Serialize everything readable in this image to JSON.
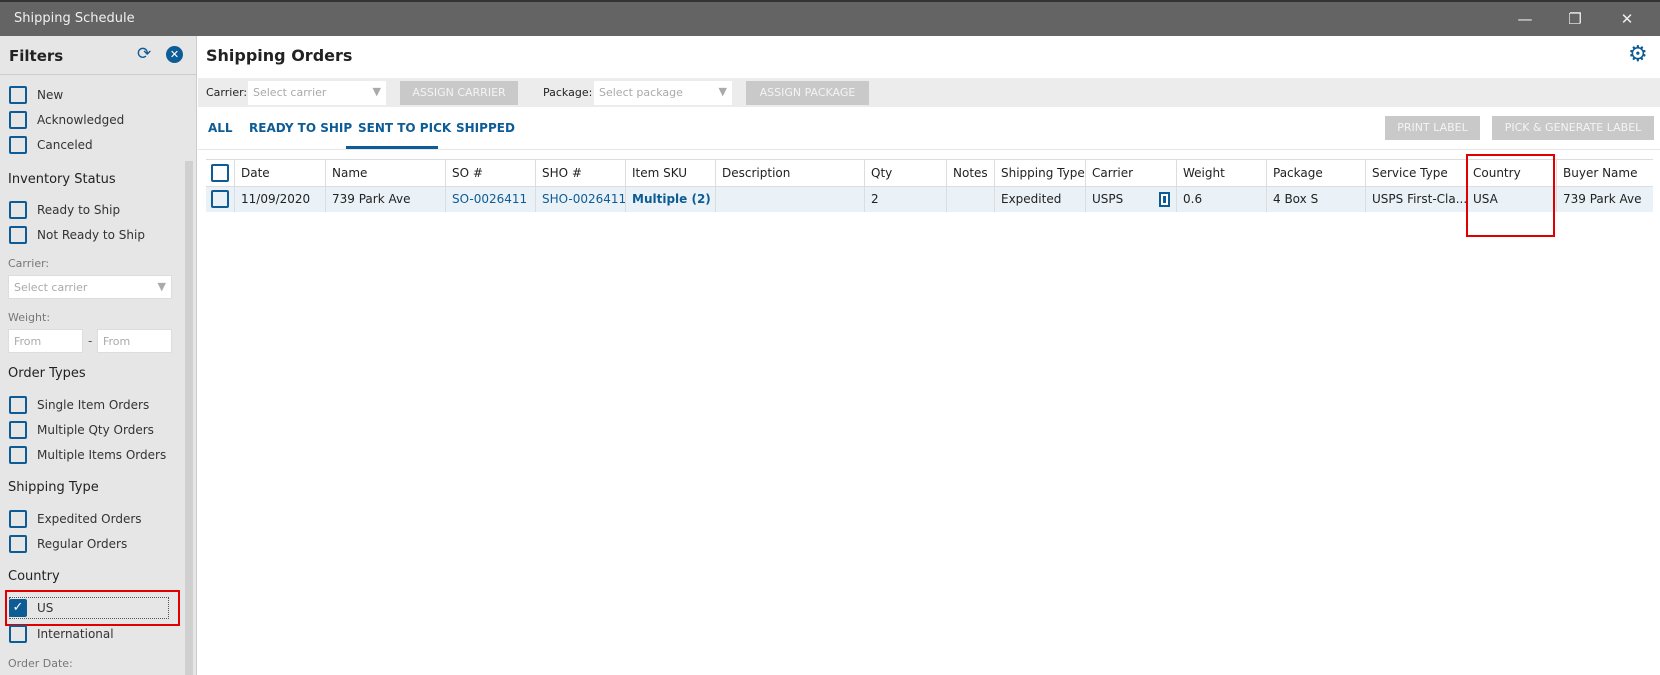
{
  "window": {
    "title": "Shipping Schedule",
    "minimize": "—",
    "restore": "❐",
    "close": "✕"
  },
  "sidebar": {
    "title": "Filters",
    "status_items": [
      {
        "label": "New",
        "checked": false
      },
      {
        "label": "Acknowledged",
        "checked": false
      },
      {
        "label": "Canceled",
        "checked": false
      }
    ],
    "inventory_title": "Inventory Status",
    "inventory_items": [
      {
        "label": "Ready to Ship",
        "checked": false
      },
      {
        "label": "Not Ready to Ship",
        "checked": false
      }
    ],
    "carrier_label": "Carrier:",
    "carrier_placeholder": "Select carrier",
    "weight_label": "Weight:",
    "weight_from_placeholder": "From",
    "weight_dash": "-",
    "weight_to_placeholder": "From",
    "order_types_title": "Order Types",
    "order_types": [
      {
        "label": "Single Item Orders"
      },
      {
        "label": "Multiple Qty Orders"
      },
      {
        "label": "Multiple Items Orders"
      }
    ],
    "shipping_type_title": "Shipping Type",
    "shipping_types": [
      {
        "label": "Expedited Orders"
      },
      {
        "label": "Regular Orders"
      }
    ],
    "country_title": "Country",
    "countries": [
      {
        "label": "US",
        "checked": true
      },
      {
        "label": "International",
        "checked": false
      }
    ],
    "order_date_label": "Order Date:"
  },
  "main": {
    "title": "Shipping Orders",
    "toolbar": {
      "carrier_label": "Carrier:",
      "carrier_placeholder": "Select carrier",
      "assign_carrier": "ASSIGN CARRIER",
      "package_label": "Package:",
      "package_placeholder": "Select package",
      "assign_package": "ASSIGN PACKAGE"
    },
    "tabs": [
      {
        "label": "ALL"
      },
      {
        "label": "READY TO SHIP"
      },
      {
        "label": "SENT TO PICK",
        "active": true
      },
      {
        "label": "SHIPPED"
      }
    ],
    "print_label": "PRINT LABEL",
    "pick_generate": "PICK & GENERATE LABEL",
    "columns": [
      "Date",
      "Name",
      "SO #",
      "SHO #",
      "Item SKU",
      "Description",
      "Qty",
      "Notes",
      "Shipping Type",
      "Carrier",
      "Weight",
      "Package",
      "Service Type",
      "Country",
      "Buyer Name"
    ],
    "rows": [
      {
        "date": "11/09/2020",
        "name": "739 Park Ave",
        "so": "SO-0026411",
        "sho": "SHO-0026411",
        "sku": "Multiple (2)",
        "description": "",
        "qty": "2",
        "notes": "",
        "shipping_type": "Expedited",
        "carrier": "USPS",
        "weight": "0.6",
        "package": "4 Box S",
        "service_type": "USPS First-Cla...",
        "country": "USA",
        "buyer": "739 Park Ave"
      }
    ]
  },
  "colors": {
    "accent": "#0e5c96",
    "highlight": "#e00000"
  }
}
